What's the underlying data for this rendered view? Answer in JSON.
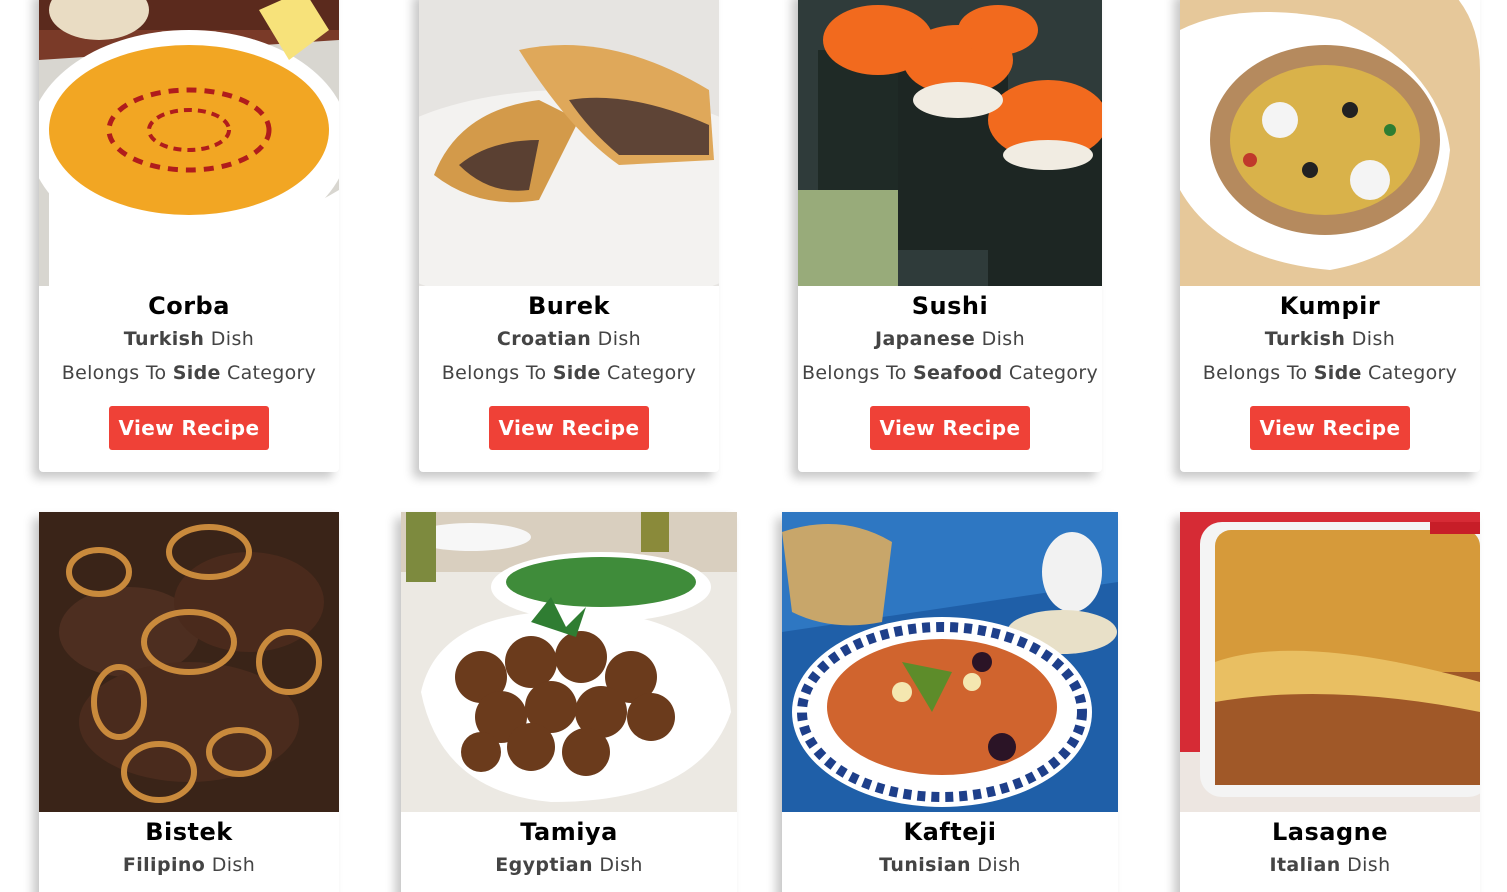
{
  "recipes": [
    {
      "name": "Corba",
      "origin": "Turkish",
      "dish_word": "Dish",
      "category_prefix": "Belongs To",
      "category": "Side",
      "category_suffix": "Category",
      "button": "View Recipe"
    },
    {
      "name": "Burek",
      "origin": "Croatian",
      "dish_word": "Dish",
      "category_prefix": "Belongs To",
      "category": "Side",
      "category_suffix": "Category",
      "button": "View Recipe"
    },
    {
      "name": "Sushi",
      "origin": "Japanese",
      "dish_word": "Dish",
      "category_prefix": "Belongs To",
      "category": "Seafood",
      "category_suffix": "Category",
      "button": "View Recipe"
    },
    {
      "name": "Kumpir",
      "origin": "Turkish",
      "dish_word": "Dish",
      "category_prefix": "Belongs To",
      "category": "Side",
      "category_suffix": "Category",
      "button": "View Recipe"
    },
    {
      "name": "Bistek",
      "origin": "Filipino",
      "dish_word": "Dish"
    },
    {
      "name": "Tamiya",
      "origin": "Egyptian",
      "dish_word": "Dish"
    },
    {
      "name": "Kafteji",
      "origin": "Tunisian",
      "dish_word": "Dish"
    },
    {
      "name": "Lasagne",
      "origin": "Italian",
      "dish_word": "Dish"
    }
  ],
  "colors": {
    "button_bg": "#ef4137",
    "button_text": "#ffffff",
    "title_text": "#000000",
    "body_text": "#444444"
  }
}
